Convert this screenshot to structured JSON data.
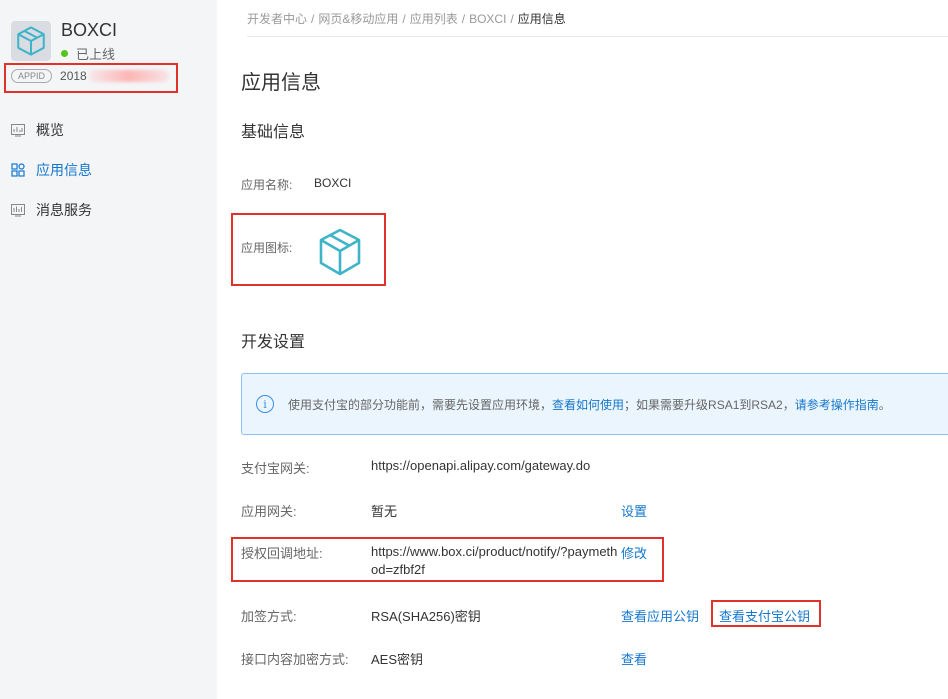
{
  "app": {
    "name": "BOXCI",
    "status": "已上线",
    "appid_badge": "APPID",
    "appid_prefix": "2018"
  },
  "sidebar": {
    "items": [
      {
        "label": "概览",
        "icon": "overview-icon"
      },
      {
        "label": "应用信息",
        "icon": "app-info-icon"
      },
      {
        "label": "消息服务",
        "icon": "message-service-icon"
      }
    ]
  },
  "breadcrumb": [
    "开发者中心",
    "网页&移动应用",
    "应用列表",
    "BOXCI",
    "应用信息"
  ],
  "page": {
    "title": "应用信息",
    "basic_section": "基础信息",
    "dev_section": "开发设置"
  },
  "basic": {
    "name_label": "应用名称:",
    "name_value": "BOXCI",
    "icon_label": "应用图标:"
  },
  "banner": {
    "text1": "使用支付宝的部分功能前，需要先设置应用环境，",
    "link1": "查看如何使用",
    "text2": "；如果需要升级RSA1到RSA2，",
    "link2": "请参考操作指南",
    "text3": "。"
  },
  "settings": {
    "gateway_label": "支付宝网关:",
    "gateway_value": "https://openapi.alipay.com/gateway.do",
    "app_gateway_label": "应用网关:",
    "app_gateway_value": "暂无",
    "app_gateway_action": "设置",
    "callback_label": "授权回调地址:",
    "callback_value": "https://www.box.ci/product/notify/?paymethod=zfbf2f",
    "callback_action": "修改",
    "sign_label": "加签方式:",
    "sign_value": "RSA(SHA256)密钥",
    "sign_action1": "查看应用公钥",
    "sign_action2": "查看支付宝公钥",
    "encrypt_label": "接口内容加密方式:",
    "encrypt_value": "AES密钥",
    "encrypt_action": "查看"
  },
  "colors": {
    "link": "#1677cc",
    "annotation": "#e0312b",
    "status_green": "#52c41a",
    "icon_teal": "#3fb4c8"
  }
}
